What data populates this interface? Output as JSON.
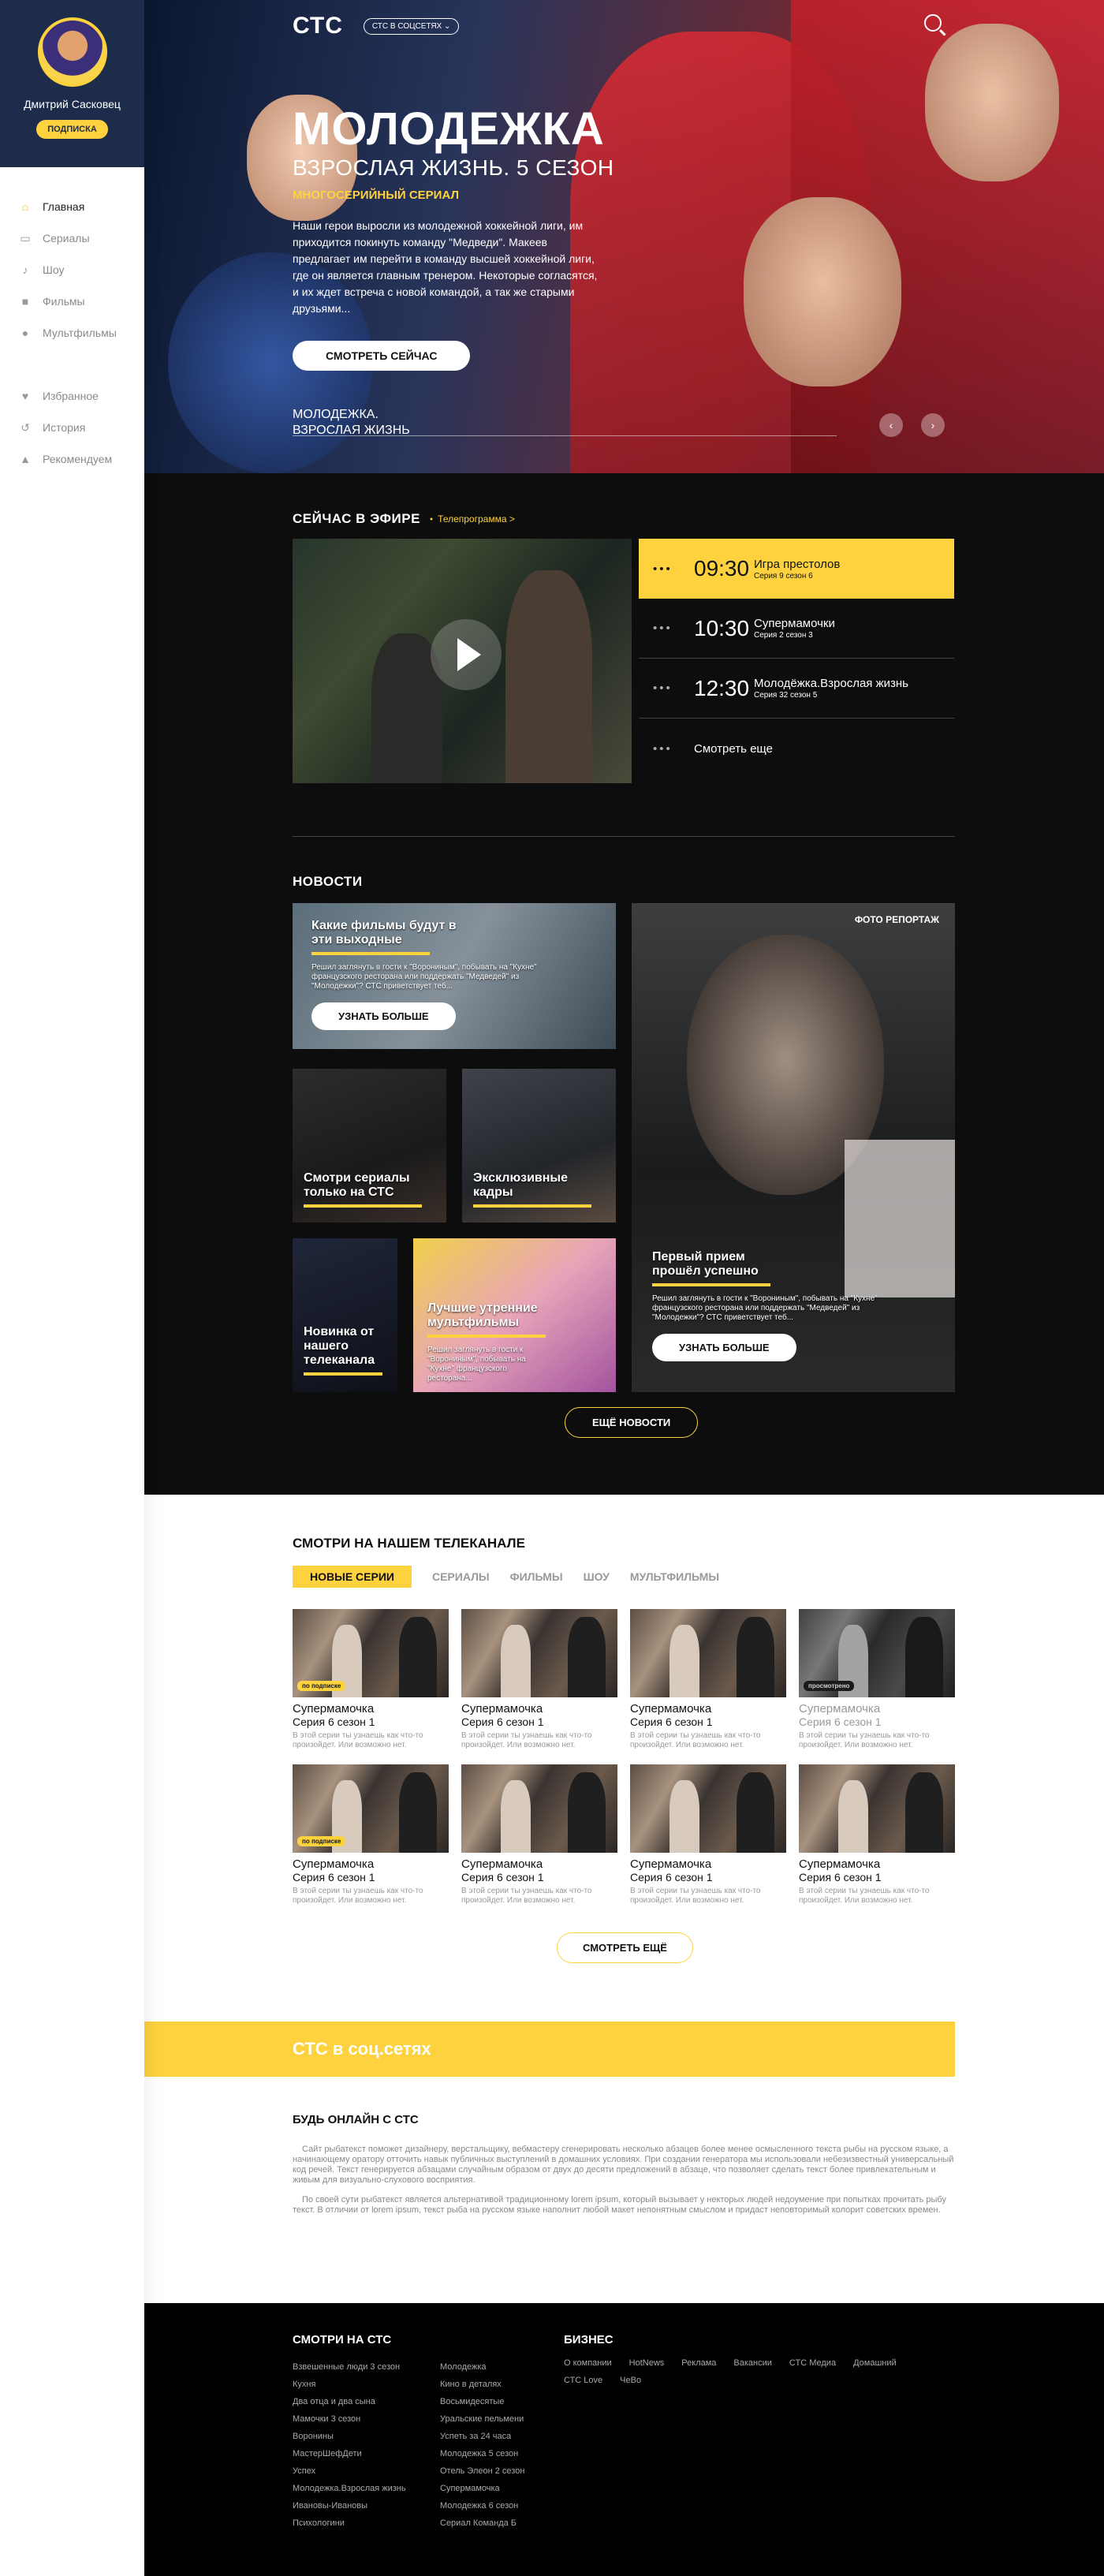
{
  "user": {
    "name": "Дмитрий Сасковец",
    "subscribe": "ПОДПИСКА"
  },
  "nav": {
    "main": [
      {
        "label": "Главная",
        "icon": "home-icon"
      },
      {
        "label": "Сериалы",
        "icon": "tv-icon"
      },
      {
        "label": "Шоу",
        "icon": "microphone-icon"
      },
      {
        "label": "Фильмы",
        "icon": "camera-icon"
      },
      {
        "label": "Мультфильмы",
        "icon": "balloon-icon"
      }
    ],
    "personal": [
      {
        "label": "Избранное",
        "icon": "heart-icon"
      },
      {
        "label": "История",
        "icon": "history-icon"
      },
      {
        "label": "Рекомендуем",
        "icon": "fire-icon"
      }
    ]
  },
  "header": {
    "logo": "СТС",
    "network": "СТС В СОЦСЕТЯХ"
  },
  "hero": {
    "title": "МОЛОДЕЖКА",
    "subtitle": "ВЗРОСЛАЯ ЖИЗНЬ. 5 СЕЗОН",
    "kind": "МНОГОСЕРИЙНЫЙ СЕРИАЛ",
    "description": "Наши герои выросли из молодежной хоккейной лиги, им приходится покинуть команду \"Медведи\". Макеев предлагает им перейти в команду высшей хоккейной лиги, где он является главным тренером. Некоторые согласятся, и их ждет встреча с новой командой, а так же старыми друзьями...",
    "watch": "СМОТРЕТЬ СЕЙЧАС",
    "bottom_line1": "МОЛОДЕЖКА.",
    "bottom_line2": "ВЗРОСЛАЯ ЖИЗНЬ"
  },
  "onair": {
    "title": "СЕЙЧАС В ЭФИРЕ",
    "link": "Телепрограмма >",
    "schedule": [
      {
        "time": "09:30",
        "title": "Игра престолов",
        "sub": "Серия 9 сезон 6"
      },
      {
        "time": "10:30",
        "title": "Супермамочки",
        "sub": "Серия 2 сезон 3"
      },
      {
        "time": "12:30",
        "title": "Молодёжка.Взрослая жизнь",
        "sub": "Серия 32 сезон 5"
      }
    ],
    "more": "Смотреть еще"
  },
  "news": {
    "title": "НОВОСТИ",
    "c1_title": "Какие фильмы будут в эти выходные",
    "c1_desc": "Решил заглянуть в гости к \"Ворониным\", побывать на \"Кухне\" французского ресторана или поддержать \"Медведей\" из \"Молодежки\"? СТС приветствует теб...",
    "c1_btn": "УЗНАТЬ БОЛЬШЕ",
    "c2_title": "Смотри сериалы только на СТС",
    "c3_title": "Эксклюзивные кадры",
    "c4_title": "Новинка от нашего телеканала",
    "c5_title": "Лучшие утренние мультфильмы",
    "c5_desc": "Решил заглянуть в гости к \"Ворониным\", побывать на \"Кухне\" французского ресторана...",
    "c6_tag": "ФОТО РЕПОРТАЖ",
    "c6_title": "Первый прием прошёл успешно",
    "c6_desc": "Решил заглянуть в гости к \"Ворониным\", побывать на \"Кухне\" французского ресторана или поддержать \"Медведей\" из \"Молодежки\"? СТС приветствует теб...",
    "c6_btn": "УЗНАТЬ БОЛЬШЕ",
    "more": "ЕЩЁ НОВОСТИ"
  },
  "watch": {
    "title": "СМОТРИ НА НАШЕМ ТЕЛЕКАНАЛЕ",
    "tabs": [
      "НОВЫЕ СЕРИИ",
      "СЕРИАЛЫ",
      "ФИЛЬМЫ",
      "ШОУ",
      "МУЛЬТФИЛЬМЫ"
    ],
    "episodes": [
      {
        "title": "Супермамочка",
        "sub": "Серия 6 сезон 1",
        "desc": "В этой серии ты узнаешь как что-то произойдет. Или возможно нет.",
        "badge": "по подписке"
      },
      {
        "title": "Супермамочка",
        "sub": "Серия 6 сезон 1",
        "desc": "В этой серии ты узнаешь как что-то произойдет. Или возможно нет.",
        "badge": ""
      },
      {
        "title": "Супермамочка",
        "sub": "Серия 6 сезон 1",
        "desc": "В этой серии ты узнаешь как что-то произойдет. Или возможно нет.",
        "badge": ""
      },
      {
        "title": "Супермамочка",
        "sub": "Серия 6 сезон 1",
        "desc": "В этой серии ты узнаешь как что-то произойдет. Или возможно нет.",
        "badge": "просмотрено"
      },
      {
        "title": "Супермамочка",
        "sub": "Серия 6 сезон 1",
        "desc": "В этой серии ты узнаешь как что-то произойдет. Или возможно нет.",
        "badge": "по подписке"
      },
      {
        "title": "Супермамочка",
        "sub": "Серия 6 сезон 1",
        "desc": "В этой серии ты узнаешь как что-то произойдет. Или возможно нет.",
        "badge": ""
      },
      {
        "title": "Супермамочка",
        "sub": "Серия 6 сезон 1",
        "desc": "В этой серии ты узнаешь как что-то произойдет. Или возможно нет.",
        "badge": ""
      },
      {
        "title": "Супермамочка",
        "sub": "Серия 6 сезон 1",
        "desc": "В этой серии ты узнаешь как что-то произойдет. Или возможно нет.",
        "badge": ""
      }
    ],
    "more": "СМОТРЕТЬ ЕЩЁ"
  },
  "social": {
    "title": "СТС в соц.сетях"
  },
  "seo": {
    "title": "БУДЬ ОНЛАЙН С СТС",
    "p1": "Сайт рыбатекст поможет дизайнеру, верстальщику, вебмастеру сгенерировать несколько абзацев более менее осмысленного текста рыбы на русском языке, а начинающему оратору отточить навык публичных выступлений в домашних условиях. При создании генератора мы использовали небезизвестный универсальный код речей. Текст генерируется абзацами случайным образом от двух до десяти предложений в абзаце, что позволяет сделать текст более привлекательным и живым для визуально-слухового восприятия.",
    "p2": "По своей сути рыбатекст является альтернативой традиционному lorem ipsum, который вызывает у некторых людей недоумение при попытках прочитать рыбу текст. В отличии от lorem ipsum, текст рыба на русском языке наполнит любой макет непонятным смыслом и придаст неповторимый колорит советских времен."
  },
  "footer": {
    "col1_title": "СМОТРИ НА СТС",
    "col1": [
      "Взвешенные люди 3 сезон",
      "Кухня",
      "Два отца и два сына",
      "Мамочки 3 сезон",
      "Воронины",
      "МастерШефДети",
      "Успех",
      "Молодежка.Взрослая жизнь",
      "Ивановы-Ивановы",
      "Психологини"
    ],
    "col2": [
      "Молодежка",
      "Кино в деталях",
      "Восьмидесятые",
      "Уральские пельмени",
      "Успеть за 24 часа",
      "Молодежка 5 сезон",
      "Отель Элеон 2 сезон",
      "Супермамочка",
      "Молодежка 6 сезон",
      "Сериал Команда Б"
    ],
    "col3_title": "БИЗНЕС",
    "col3": [
      "О компании",
      "HotNews",
      "Реклама",
      "Вакансии",
      "СТС Медиа",
      "Домашний"
    ],
    "col3b": [
      "СТС Love",
      "ЧеВо"
    ]
  }
}
